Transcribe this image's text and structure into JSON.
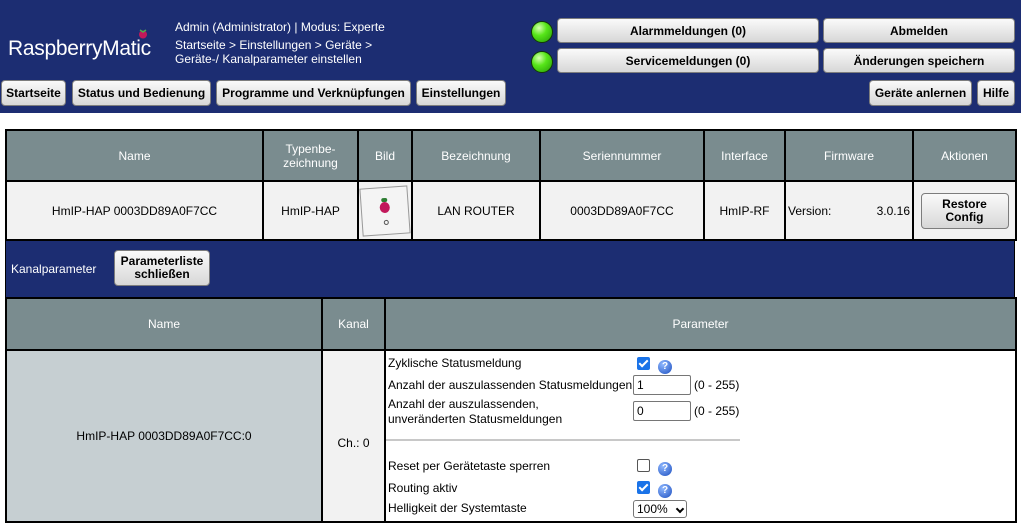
{
  "header": {
    "logo_text": "RaspberryMatic",
    "user_info": "Admin (Administrator) | Modus: Experte",
    "breadcrumb_line1": "Startseite > Einstellungen > Geräte >",
    "breadcrumb_line2": "Geräte-/ Kanalparameter einstellen",
    "alarm_button": "Alarmmeldungen (0)",
    "service_button": "Servicemeldungen (0)",
    "logout_button": "Abmelden",
    "save_button": "Änderungen speichern",
    "status_led_color": "#57e619"
  },
  "nav": {
    "items": [
      "Startseite",
      "Status und Bedienung",
      "Programme und Verknüpfungen",
      "Einstellungen"
    ],
    "teach_in": "Geräte anlernen",
    "help": "Hilfe"
  },
  "device_table": {
    "headers": [
      "Name",
      "Typenbe-\nzeichnung",
      "Bild",
      "Bezeichnung",
      "Seriennummer",
      "Interface",
      "Firmware",
      "Aktionen"
    ],
    "row": {
      "name": "HmIP-HAP 0003DD89A0F7CC",
      "type": "HmIP-HAP",
      "image_icon": "lan-router-device-icon",
      "description": "LAN ROUTER",
      "serial": "0003DD89A0F7CC",
      "interface": "HmIP-RF",
      "firmware_label": "Version:",
      "firmware_value": "3.0.16",
      "action_button": "Restore\nConfig"
    }
  },
  "kanal": {
    "label": "Kanalparameter",
    "close_button": "Parameterliste\nschließen"
  },
  "param_table": {
    "headers": [
      "Name",
      "Kanal",
      "Parameter"
    ],
    "name": "HmIP-HAP 0003DD89A0F7CC:0",
    "channel": "Ch.: 0",
    "params": {
      "cyclic_status": {
        "label": "Zyklische Statusmeldung",
        "checked": true
      },
      "skip_status": {
        "label": "Anzahl der auszulassenden Statusmeldungen",
        "value": "1",
        "range": "(0 - 255)"
      },
      "skip_unchanged": {
        "label_line1": "Anzahl der auszulassenden,",
        "label_line2": "unveränderten Statusmeldungen",
        "value": "0",
        "range": "(0 - 255)"
      },
      "reset_lock": {
        "label": "Reset per Gerätetaste sperren",
        "checked": false
      },
      "routing": {
        "label": "Routing aktiv",
        "checked": true
      },
      "brightness": {
        "label": "Helligkeit der Systemtaste",
        "value": "100%"
      }
    },
    "help_glyph": "?"
  }
}
